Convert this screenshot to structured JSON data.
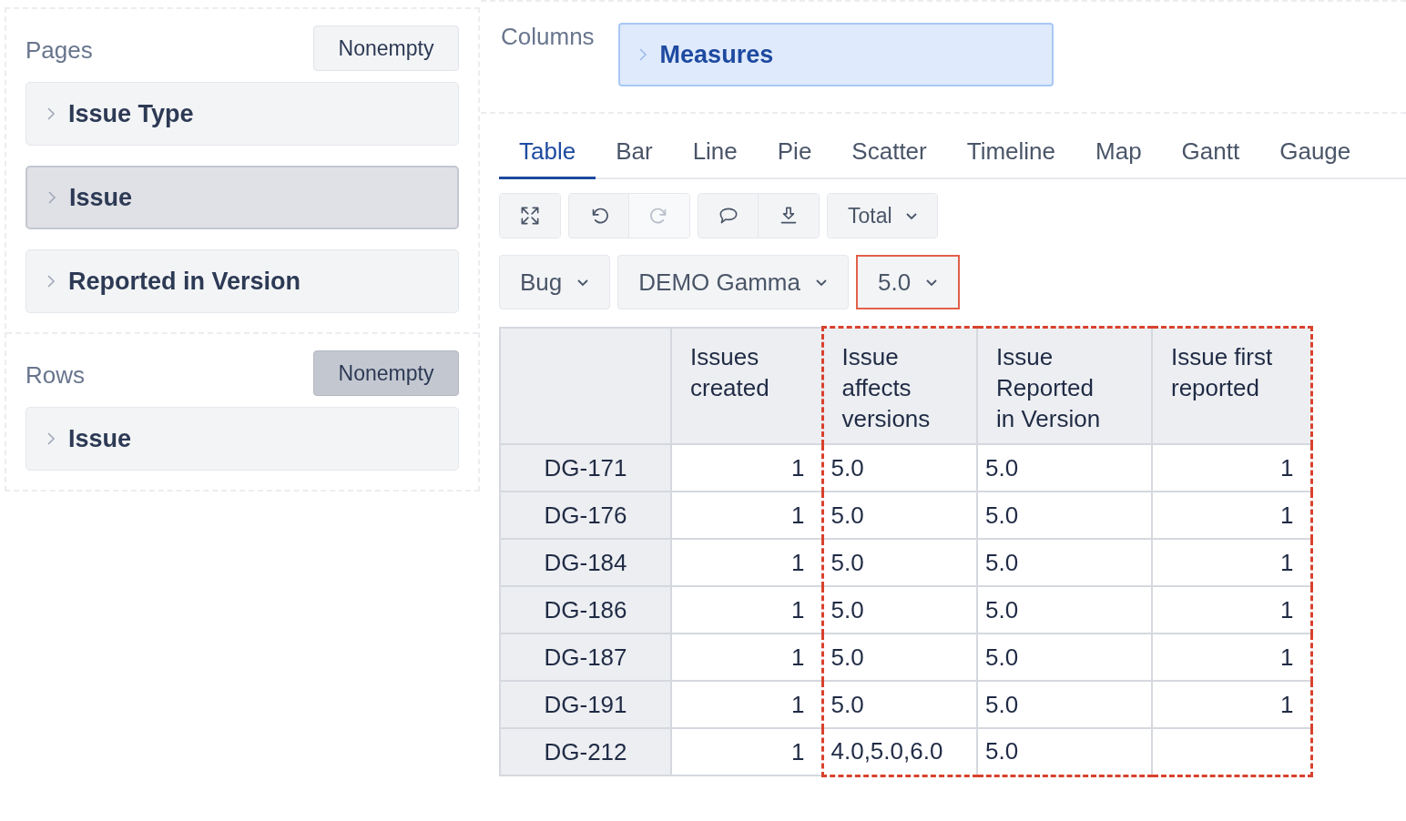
{
  "pages": {
    "title": "Pages",
    "nonempty": {
      "label": "Nonempty",
      "on": false
    },
    "items": [
      {
        "label": "Issue Type",
        "selected": false
      },
      {
        "label": "Issue",
        "selected": true
      },
      {
        "label": "Reported in Version",
        "selected": false
      }
    ]
  },
  "rows": {
    "title": "Rows",
    "nonempty": {
      "label": "Nonempty",
      "on": true
    },
    "items": [
      {
        "label": "Issue",
        "selected": false
      }
    ]
  },
  "columns": {
    "title": "Columns",
    "items": [
      {
        "label": "Measures"
      }
    ]
  },
  "tabs": [
    {
      "label": "Table",
      "selected": true
    },
    {
      "label": "Bar",
      "selected": false
    },
    {
      "label": "Line",
      "selected": false
    },
    {
      "label": "Pie",
      "selected": false
    },
    {
      "label": "Scatter",
      "selected": false
    },
    {
      "label": "Timeline",
      "selected": false
    },
    {
      "label": "Map",
      "selected": false
    },
    {
      "label": "Gantt",
      "selected": false
    },
    {
      "label": "Gauge",
      "selected": false
    }
  ],
  "toolbar": [
    [
      {
        "kind": "expand",
        "disabled": false
      }
    ],
    [
      {
        "kind": "undo",
        "disabled": false
      },
      {
        "kind": "redo",
        "disabled": true
      }
    ],
    [
      {
        "kind": "comment",
        "disabled": false
      },
      {
        "kind": "download",
        "disabled": false
      }
    ],
    [
      {
        "kind": "dropdown",
        "label": "Total",
        "disabled": false
      }
    ]
  ],
  "filters": [
    {
      "label": "Bug",
      "highlighted": false
    },
    {
      "label": "DEMO Gamma",
      "highlighted": false
    },
    {
      "label": "5.0",
      "highlighted": true
    }
  ],
  "table": {
    "columns": [
      {
        "label": "Issues created",
        "kind": "number",
        "highlighted": false
      },
      {
        "label": "Issue affects versions",
        "kind": "text",
        "highlighted": true
      },
      {
        "label": "Issue Reported in Version",
        "kind": "text",
        "highlighted": true
      },
      {
        "label": "Issue first reported",
        "kind": "number",
        "highlighted": true
      }
    ],
    "rows": [
      {
        "header": "DG-171",
        "cells": [
          "1",
          "5.0",
          "5.0",
          "1"
        ]
      },
      {
        "header": "DG-176",
        "cells": [
          "1",
          "5.0",
          "5.0",
          "1"
        ]
      },
      {
        "header": "DG-184",
        "cells": [
          "1",
          "5.0",
          "5.0",
          "1"
        ]
      },
      {
        "header": "DG-186",
        "cells": [
          "1",
          "5.0",
          "5.0",
          "1"
        ]
      },
      {
        "header": "DG-187",
        "cells": [
          "1",
          "5.0",
          "5.0",
          "1"
        ]
      },
      {
        "header": "DG-191",
        "cells": [
          "1",
          "5.0",
          "5.0",
          "1"
        ]
      },
      {
        "header": "DG-212",
        "cells": [
          "1",
          "4.0,5.0,6.0",
          "5.0",
          null
        ]
      }
    ]
  }
}
